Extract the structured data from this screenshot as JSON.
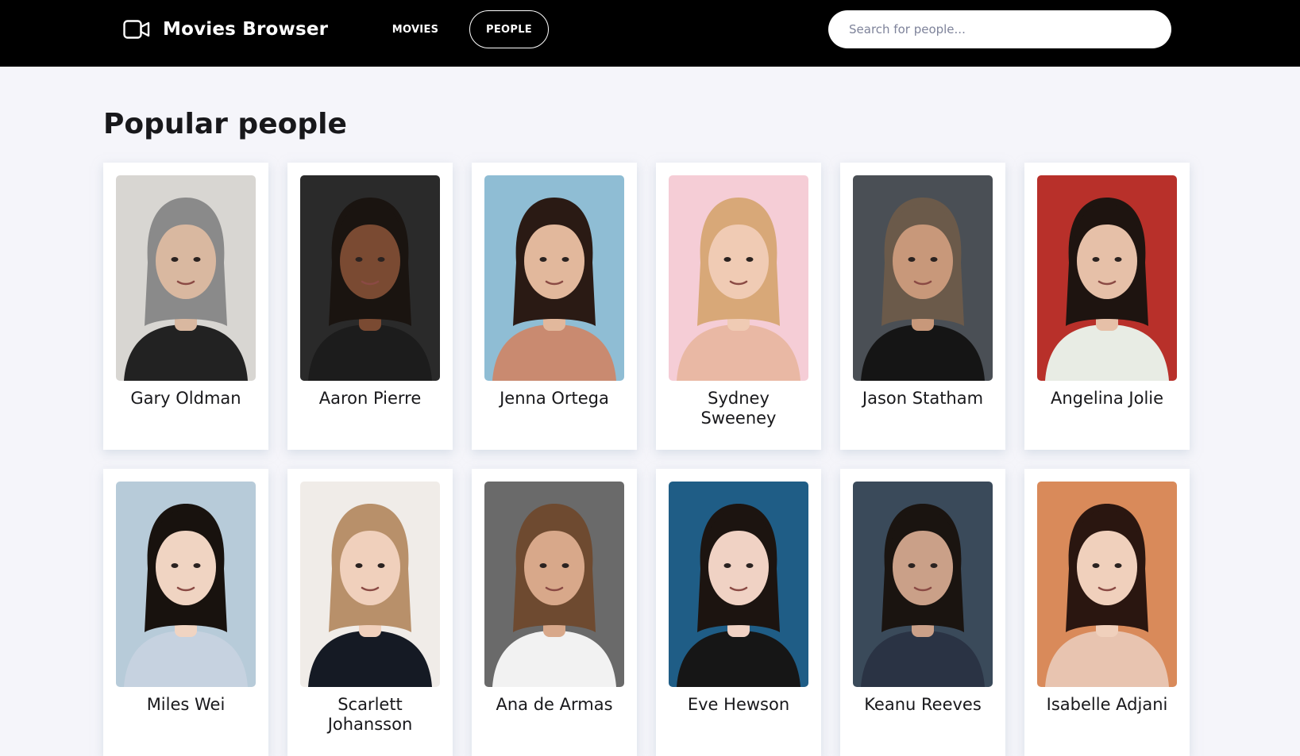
{
  "app": {
    "title": "Movies Browser",
    "logo_icon": "video-camera-icon"
  },
  "nav": {
    "movies_label": "MOVIES",
    "people_label": "PEOPLE",
    "active": "PEOPLE"
  },
  "search": {
    "placeholder": "Search for people...",
    "value": ""
  },
  "main": {
    "title": "Popular people"
  },
  "people": [
    {
      "name": "Gary Oldman",
      "bg": "#d8d6d2",
      "hair": "#8a8a8a",
      "skin": "#d9b8a0",
      "shirt": "#222222"
    },
    {
      "name": "Aaron Pierre",
      "bg": "#2a2a2a",
      "hair": "#1a1410",
      "skin": "#7a4a32",
      "shirt": "#1c1c1c"
    },
    {
      "name": "Jenna Ortega",
      "bg": "#8fbdd4",
      "hair": "#2a1a14",
      "skin": "#e2b89c",
      "shirt": "#c98a70"
    },
    {
      "name": "Sydney Sweeney",
      "bg": "#f5cdd6",
      "hair": "#d8a878",
      "skin": "#f0cbb4",
      "shirt": "#e9b8a4"
    },
    {
      "name": "Jason Statham",
      "bg": "#4a4f55",
      "hair": "#6b5a4a",
      "skin": "#c8987a",
      "shirt": "#151515"
    },
    {
      "name": "Angelina Jolie",
      "bg": "#b8302a",
      "hair": "#1e1410",
      "skin": "#e6c0a8",
      "shirt": "#e8ece4"
    },
    {
      "name": "Miles Wei",
      "bg": "#b7cbd9",
      "hair": "#18120e",
      "skin": "#f0d4c2",
      "shirt": "#c6d2e0"
    },
    {
      "name": "Scarlett Johansson",
      "bg": "#f0ece8",
      "hair": "#b8906a",
      "skin": "#f0d0bc",
      "shirt": "#151a24"
    },
    {
      "name": "Ana de Armas",
      "bg": "#6a6a6a",
      "hair": "#6e4a30",
      "skin": "#d8a88a",
      "shirt": "#f2f2f2"
    },
    {
      "name": "Eve Hewson",
      "bg": "#1f5d86",
      "hair": "#1c1410",
      "skin": "#f0d2c4",
      "shirt": "#161616"
    },
    {
      "name": "Keanu Reeves",
      "bg": "#3a4a5a",
      "hair": "#1a1410",
      "skin": "#caa088",
      "shirt": "#2a3344"
    },
    {
      "name": "Isabelle Adjani",
      "bg": "#d98a5a",
      "hair": "#2a1610",
      "skin": "#f0d0bc",
      "shirt": "#e8c4b0"
    }
  ]
}
